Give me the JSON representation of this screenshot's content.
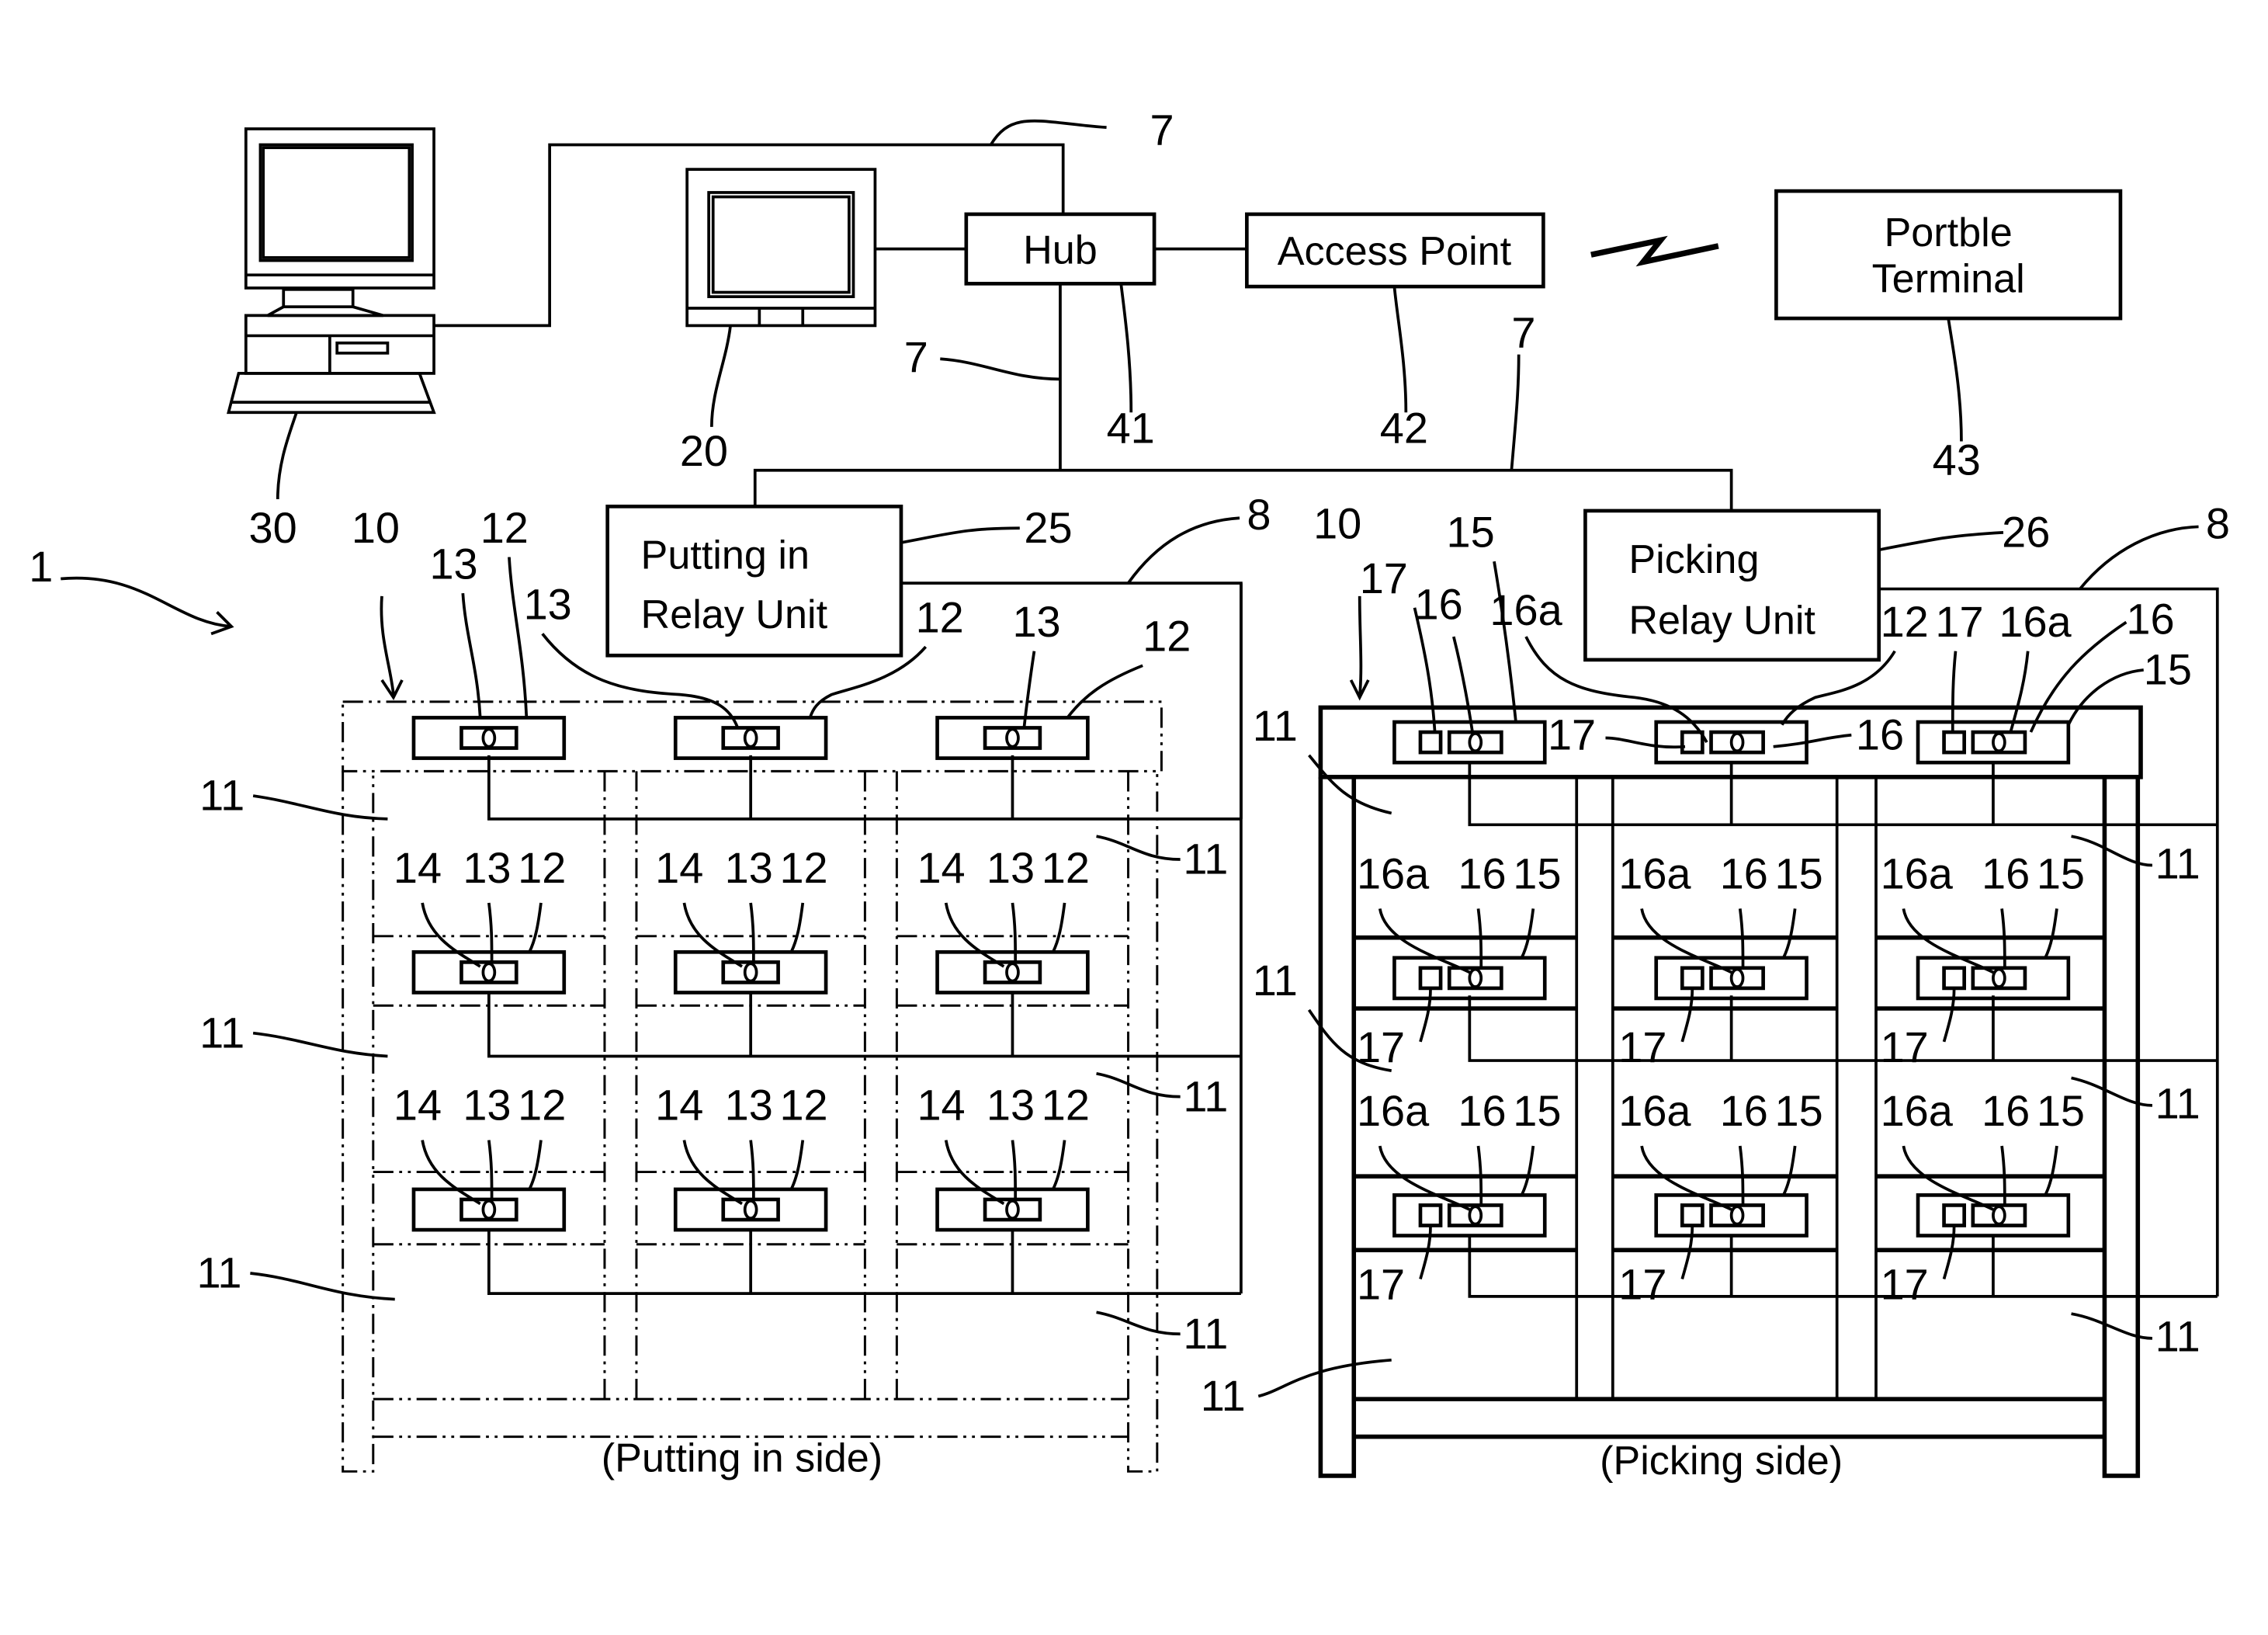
{
  "figure": {
    "network": {
      "hub": "Hub",
      "access_point": "Access Point",
      "portable_terminal_line1": "Portble",
      "portable_terminal_line2": "Terminal",
      "putting_relay_line1": "Putting in",
      "putting_relay_line2": "Relay Unit",
      "picking_relay_line1": "Picking",
      "picking_relay_line2": "Relay Unit"
    },
    "captions": {
      "putting_side": "(Putting in side)",
      "picking_side": "(Picking side)"
    },
    "ref": {
      "system": "1",
      "lan_a": "7",
      "lan_b": "7",
      "lan_c": "7",
      "line_left": "8",
      "line_right": "8",
      "rack_left": "10",
      "rack_right": "10",
      "monitor": "20",
      "putting_relay": "25",
      "picking_relay": "26",
      "host": "30",
      "hub": "41",
      "access_point": "42",
      "portable_terminal": "43"
    },
    "putting_labels": {
      "top": [
        "13",
        "12",
        "13",
        "12",
        "13",
        "12"
      ],
      "row": [
        "14",
        "13",
        "12"
      ],
      "shelf": "11"
    },
    "picking_labels": {
      "top_left": [
        "17",
        "16",
        "15",
        "16a"
      ],
      "top_right": [
        "12",
        "17",
        "16a",
        "16",
        "15"
      ],
      "top_mid": [
        "17",
        "16"
      ],
      "row": [
        "16a",
        "16",
        "15"
      ],
      "lamp": "17",
      "shelf": "11"
    }
  }
}
